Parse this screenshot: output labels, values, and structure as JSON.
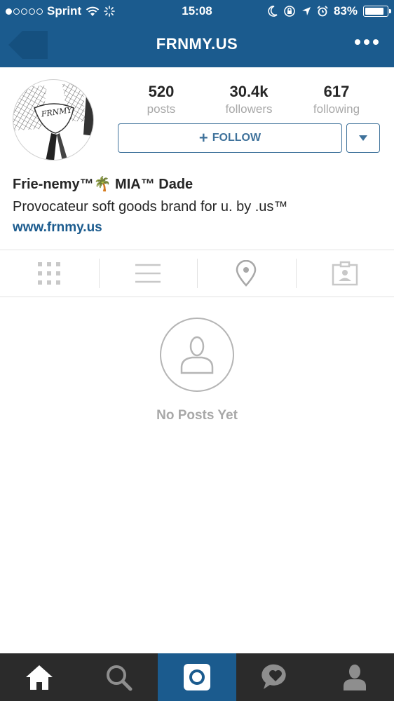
{
  "status_bar": {
    "carrier": "Sprint",
    "time": "15:08",
    "battery_percent": "83%",
    "battery_level": 0.83,
    "signal_bars_filled": 1,
    "signal_bars_total": 5
  },
  "header": {
    "title": "FRNMY.US",
    "background_color": "#1b5b8e",
    "back_icon": "back-arrow-icon",
    "more_icon": "more-dots-icon"
  },
  "profile": {
    "avatar_logo_text": "FRNMY",
    "stats": [
      {
        "value": "520",
        "label": "posts"
      },
      {
        "value": "30.4k",
        "label": "followers"
      },
      {
        "value": "617",
        "label": "following"
      }
    ],
    "follow_label": "FOLLOW",
    "name": "Frie-nemy™🌴 MIA™ Dade",
    "bio": "Provocateur soft goods brand for u. by .us™",
    "website": "www.frnmy.us",
    "accent_color": "#3f729b"
  },
  "tabs": [
    {
      "name": "grid-view",
      "icon": "grid-icon"
    },
    {
      "name": "list-view",
      "icon": "list-icon"
    },
    {
      "name": "map-view",
      "icon": "location-pin-icon"
    },
    {
      "name": "tagged-view",
      "icon": "tagged-person-icon"
    }
  ],
  "empty_state": {
    "icon": "person-icon",
    "message": "No Posts Yet"
  },
  "bottom_nav": [
    {
      "name": "home",
      "icon": "home-icon",
      "active": false
    },
    {
      "name": "search",
      "icon": "search-icon",
      "active": false
    },
    {
      "name": "camera",
      "icon": "camera-icon",
      "active": true
    },
    {
      "name": "activity",
      "icon": "heart-bubble-icon",
      "active": false
    },
    {
      "name": "profile",
      "icon": "profile-icon",
      "active": false
    }
  ]
}
